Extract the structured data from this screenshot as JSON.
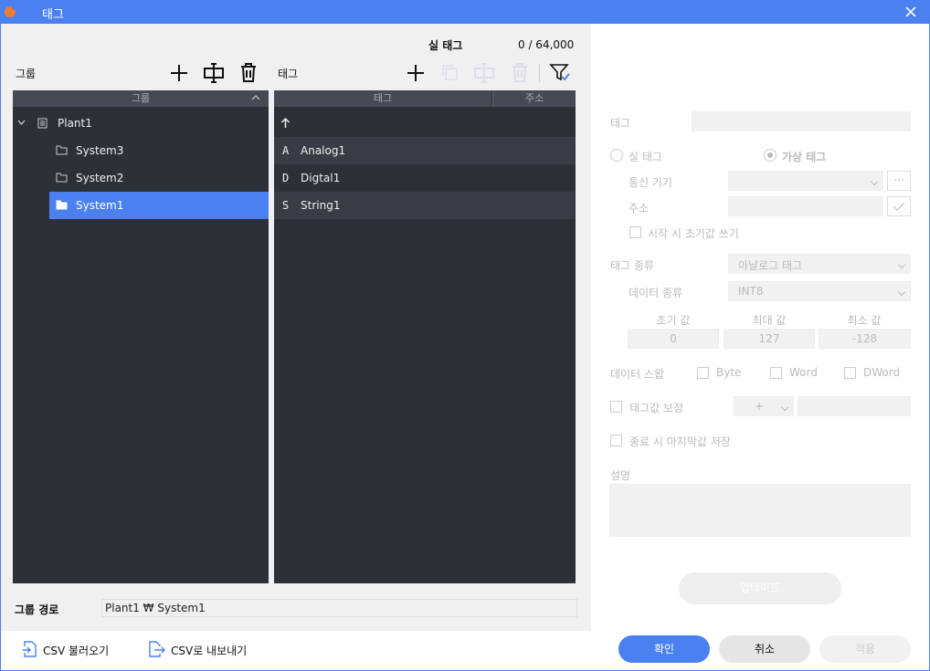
{
  "window": {
    "title": "태그",
    "close_icon": "close-icon",
    "logo_icon": "app-logo-icon"
  },
  "real_tag_count": {
    "label": "실 태그",
    "value": "0 / 64,000"
  },
  "group_panel": {
    "title": "그룹",
    "column_header": "그룹",
    "tree": [
      {
        "label": "Plant1",
        "icon": "page-icon"
      },
      {
        "label": "System3",
        "icon": "folder-icon"
      },
      {
        "label": "System2",
        "icon": "folder-icon"
      },
      {
        "label": "System1",
        "icon": "folder-icon",
        "selected": true
      }
    ]
  },
  "tag_panel": {
    "title": "태그",
    "columns": [
      "태그",
      "주소"
    ],
    "rows": [
      {
        "type": "",
        "name": ""
      },
      {
        "type": "A",
        "name": "Analog1"
      },
      {
        "type": "D",
        "name": "Digtal1"
      },
      {
        "type": "S",
        "name": "String1"
      }
    ]
  },
  "group_path": {
    "label": "그룹 경로",
    "value": "Plant1 ₩ System1"
  },
  "details": {
    "tag_label": "태그",
    "tag_value": "",
    "real_tag": "실 태그",
    "virtual_tag": "가상 태그",
    "comm_device": "통신 기기",
    "address": "주소",
    "write_initial": "시작 시 초기값 쓰기",
    "tag_type_label": "태그 종류",
    "tag_type_value": "아날로그 태그",
    "data_type_label": "데이터 종류",
    "data_type_value": "INT8",
    "initial_label": "초기 값",
    "max_label": "최대 값",
    "min_label": "최소 값",
    "initial_value": "0",
    "max_value": "127",
    "min_value": "-128",
    "data_swap_label": "데이터 스왑",
    "swap_byte": "Byte",
    "swap_word": "Word",
    "swap_dword": "DWord",
    "tag_correction": "태그값 보정",
    "correction_op": "+",
    "save_last": "종료 시 마지막값 저장",
    "description_label": "설명",
    "update_button": "업데이트"
  },
  "footer": {
    "csv_import": "CSV 불러오기",
    "csv_export": "CSV로 내보내기",
    "ok": "확인",
    "cancel": "취소",
    "apply": "적용"
  },
  "colors": {
    "accent": "#4a80f0",
    "grid_bg": "#2e3038",
    "selected_row": "#4a80f0"
  }
}
